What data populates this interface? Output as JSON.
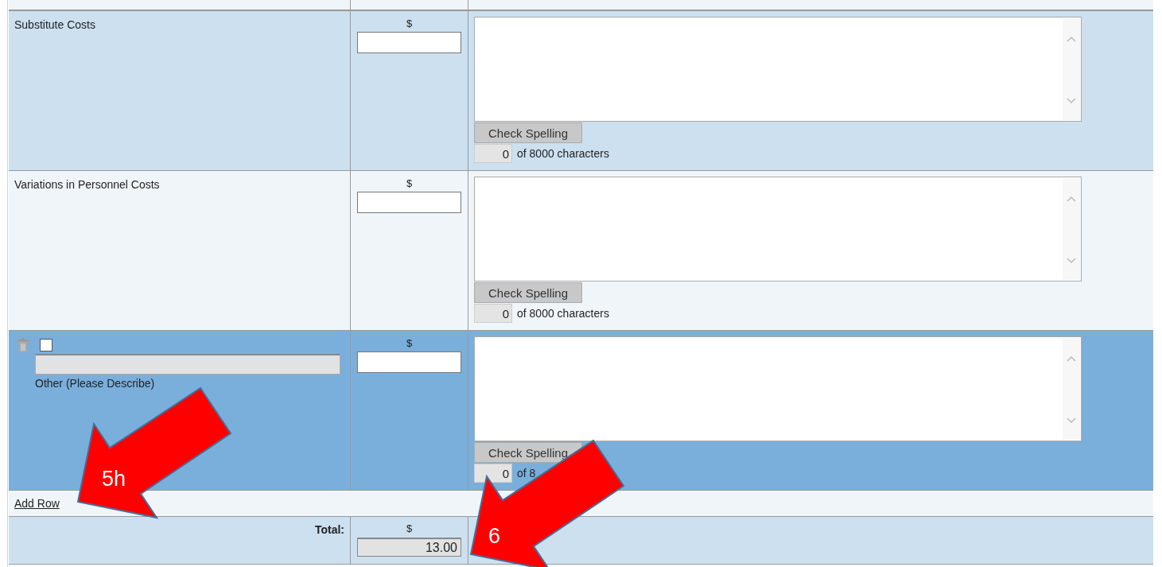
{
  "rows": [
    {
      "kind": "fixed",
      "label": "Substitute Costs",
      "highlighted": false,
      "currency": "$",
      "spell_button": "Check Spelling",
      "count": "0",
      "count_suffix": "of 8000 characters"
    },
    {
      "kind": "fixed",
      "label": "Variations in Personnel Costs",
      "highlighted": false,
      "currency": "$",
      "spell_button": "Check Spelling",
      "count": "0",
      "count_suffix": "of 8000 characters"
    },
    {
      "kind": "custom",
      "label": "Other (Please Describe)",
      "highlighted": true,
      "checked": false,
      "currency": "$",
      "spell_button": "Check Spelling",
      "count": "0",
      "count_suffix": "of 8"
    }
  ],
  "add_row": "Add Row",
  "total": {
    "label": "Total:",
    "currency": "$",
    "value": "13.00"
  },
  "annotations": [
    {
      "label": "5h"
    },
    {
      "label": "6"
    }
  ]
}
